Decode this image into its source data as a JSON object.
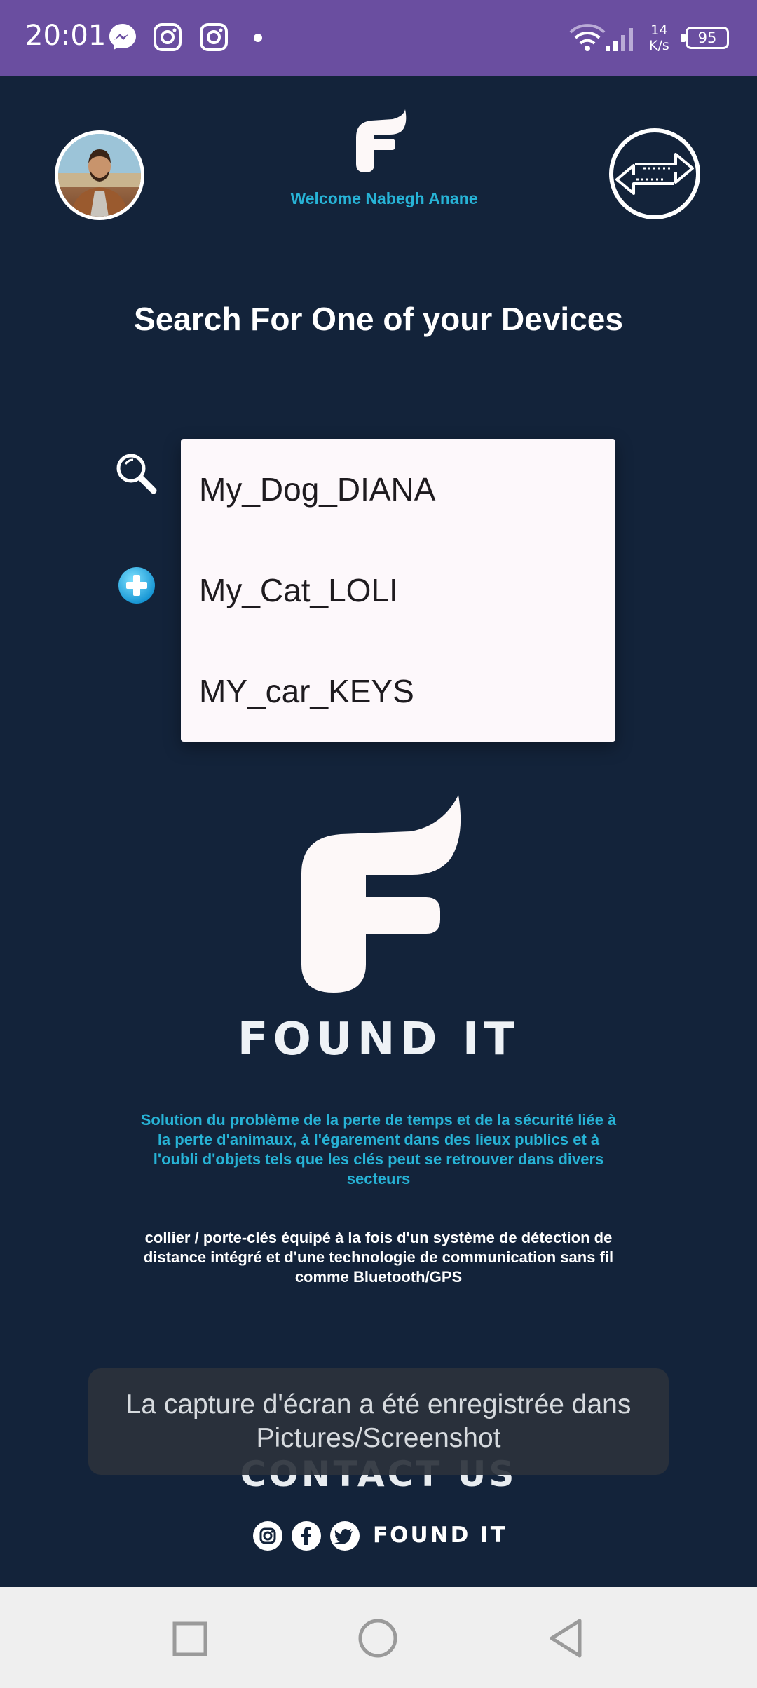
{
  "status_bar": {
    "time": "20:01",
    "icons": [
      "messenger-icon",
      "instagram-icon",
      "instagram-icon",
      "dot-icon",
      "wifi-icon",
      "signal-icon"
    ],
    "speed_value": "14",
    "speed_unit": "K/s",
    "battery": "95"
  },
  "header": {
    "welcome": "Welcome Nabegh Anane",
    "avatar_icon": "profile-avatar",
    "switch_icon": "switch-arrows-icon"
  },
  "main": {
    "title": "Search For One of your Devices",
    "search_icon": "search-icon",
    "add_icon": "add-circle-icon",
    "dropdown_items": [
      "My_Dog_DIANA",
      "My_Cat_LOLI",
      "MY_car_KEYS"
    ]
  },
  "brand": {
    "name": "FOUND IT",
    "description": "Solution du problème de la perte de temps et de la sécurité liée à la perte d'animaux, à l'égarement dans des lieux publics et à l'oubli d'objets tels que les clés peut se retrouver dans divers secteurs",
    "description2": "collier / porte-clés équipé à la fois d'un système de détection de distance intégré et d'une technologie de communication sans fil comme Bluetooth/GPS"
  },
  "footer": {
    "contact": "CONTACT US",
    "brand": "FOUND IT",
    "social": [
      "instagram-icon",
      "facebook-icon",
      "twitter-icon"
    ]
  },
  "toast": {
    "message": "La capture d'écran a été enregistrée dans Pictures/Screenshot"
  },
  "colors": {
    "background": "#13233a",
    "status_bar": "#6a4ea0",
    "accent": "#27b3d6",
    "dropdown_bg": "#fdf8fb"
  }
}
